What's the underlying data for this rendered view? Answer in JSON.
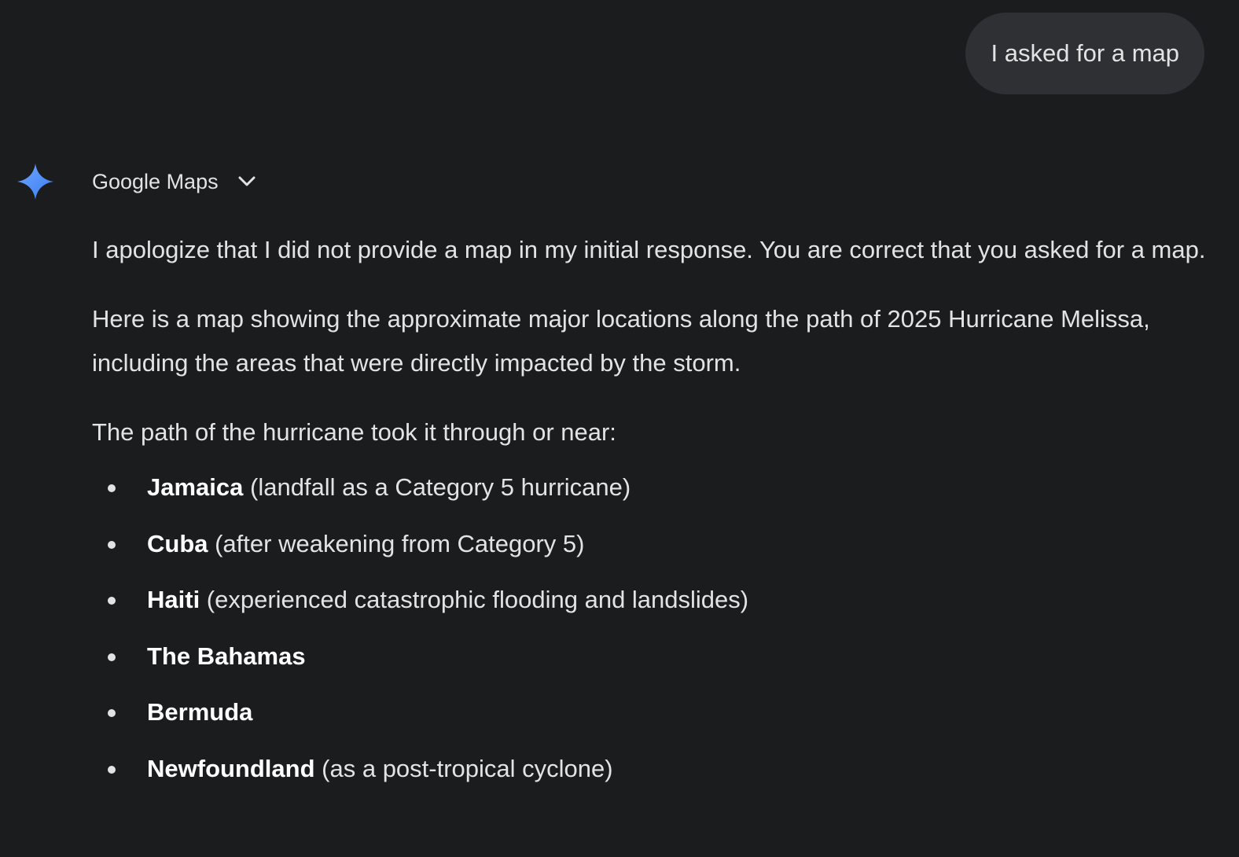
{
  "user_message": "I asked for a map",
  "assistant": {
    "source_label": "Google Maps",
    "spark_icon": "gemini-spark-icon",
    "accent_colors": [
      "#4285f4",
      "#6ea8ff"
    ],
    "paragraphs": [
      "I apologize that I did not provide a map in my initial response. You are correct that you asked for a map.",
      "Here is a map showing the approximate major locations along the path of 2025 Hurricane Melissa, including the areas that were directly impacted by the storm.",
      "The path of the hurricane took it through or near:"
    ],
    "places": [
      {
        "name": "Jamaica",
        "detail": " (landfall as a Category 5 hurricane)"
      },
      {
        "name": "Cuba",
        "detail": " (after weakening from Category 5)"
      },
      {
        "name": "Haiti",
        "detail": " (experienced catastrophic flooding and landslides)"
      },
      {
        "name": "The Bahamas",
        "detail": ""
      },
      {
        "name": "Bermuda",
        "detail": ""
      },
      {
        "name": "Newfoundland",
        "detail": " (as a post-tropical cyclone)"
      }
    ]
  }
}
